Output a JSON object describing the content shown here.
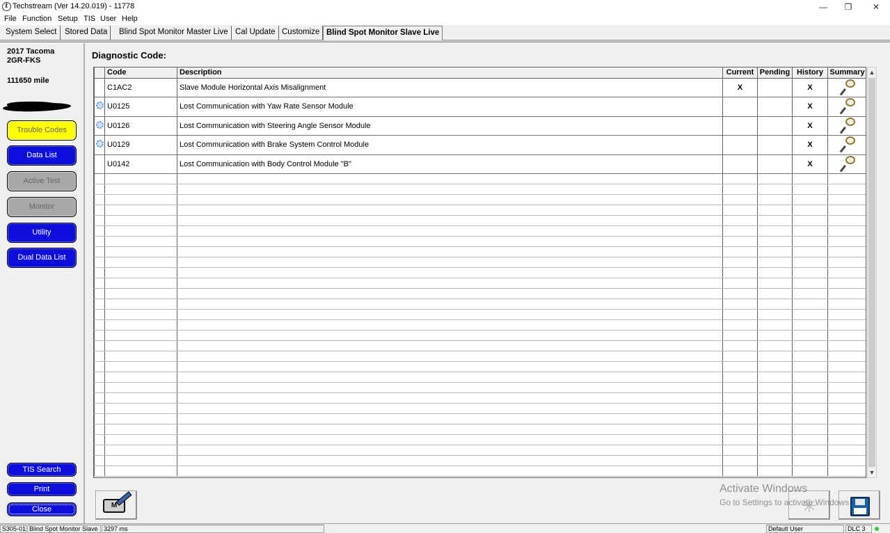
{
  "window": {
    "title": "Techstream (Ver 14.20.019) - 11778",
    "minimize": "—",
    "restore": "❐",
    "close": "✕"
  },
  "menu": [
    "File",
    "Function",
    "Setup",
    "TIS",
    "User",
    "Help"
  ],
  "tabs": [
    {
      "label": "System Select"
    },
    {
      "label": "Stored Data"
    },
    {
      "label": "Blind Spot Monitor Master Live"
    },
    {
      "label": "Cal Update"
    },
    {
      "label": "Customize"
    },
    {
      "label": "Blind Spot Monitor Slave Live",
      "active": true
    }
  ],
  "vehicle": {
    "model": "2017 Tacoma",
    "engine": "2GR-FKS",
    "mileage": "111650 mile"
  },
  "nav": {
    "trouble_codes": "Trouble Codes",
    "data_list": "Data List",
    "active_test": "Active Test",
    "monitor": "Monitor",
    "utility": "Utility",
    "dual_data_list": "Dual Data List",
    "tis_search": "TIS Search",
    "print": "Print",
    "close": "Close"
  },
  "main": {
    "title": "Diagnostic Code:",
    "columns": {
      "code": "Code",
      "description": "Description",
      "current": "Current",
      "pending": "Pending",
      "history": "History",
      "summary": "Summary"
    },
    "rows": [
      {
        "code": "C1AC2",
        "description": "Slave Module Horizontal Axis Misalignment",
        "current": "X",
        "pending": "",
        "history": "X",
        "gear": false
      },
      {
        "code": "U0125",
        "description": "Lost Communication with Yaw Rate Sensor Module",
        "current": "",
        "pending": "",
        "history": "X",
        "gear": true
      },
      {
        "code": "U0126",
        "description": "Lost Communication with Steering Angle Sensor Module",
        "current": "",
        "pending": "",
        "history": "X",
        "gear": true
      },
      {
        "code": "U0129",
        "description": "Lost Communication with Brake System Control Module",
        "current": "",
        "pending": "",
        "history": "X",
        "gear": true
      },
      {
        "code": "U0142",
        "description": "Lost Communication with Body Control Module \"B\"",
        "current": "",
        "pending": "",
        "history": "X",
        "gear": false
      }
    ]
  },
  "icons": {
    "engine_label": "M",
    "scroll_up": "▲",
    "scroll_down": "▼",
    "snowflake": "✳"
  },
  "watermark": {
    "line1": "Activate Windows",
    "line2": "Go to Settings to activate Windows."
  },
  "status": {
    "code": "S305-01",
    "module": "Blind Spot Monitor Slave",
    "time": "3297 ms",
    "user": "Default User",
    "dlc": "DLC 3"
  },
  "colors": {
    "nav_blue": "#0d0ddc",
    "nav_yellow": "#ffff00",
    "nav_gray": "#a8a8a8",
    "status_ok": "#2bd42b"
  }
}
